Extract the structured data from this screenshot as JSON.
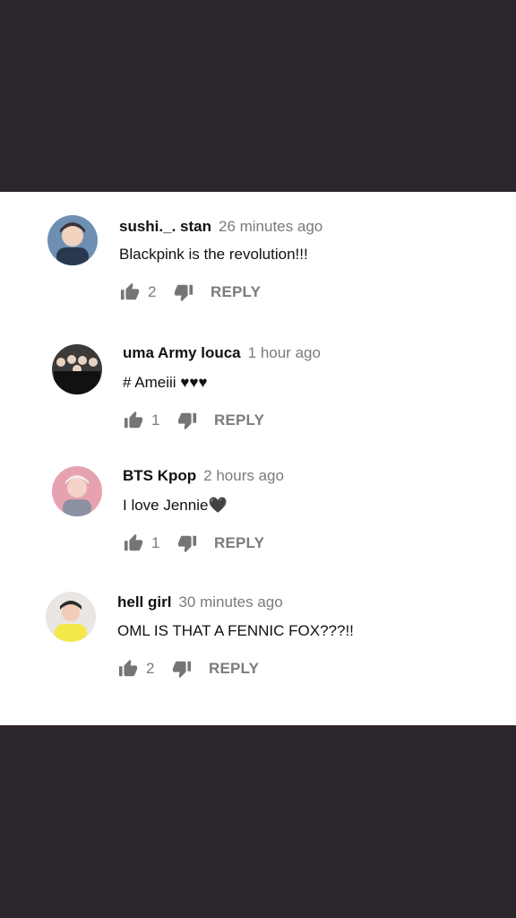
{
  "colors": {
    "background": "#2d252c",
    "panel": "#ffffff",
    "text": "#111111",
    "muted": "#7b7b7b"
  },
  "comments": [
    {
      "author": "sushi._. stan",
      "time": "26 minutes ago",
      "text": "Blackpink is the revolution!!!",
      "likes": "2",
      "reply_label": "REPLY",
      "avatar_icon": "avatar-photo"
    },
    {
      "author": "uma Army louca",
      "time": "1 hour ago",
      "text": "# Ameiii ♥♥♥",
      "likes": "1",
      "reply_label": "REPLY",
      "avatar_icon": "avatar-photo"
    },
    {
      "author": "BTS Kpop",
      "time": "2 hours ago",
      "text": "I love Jennie🖤",
      "likes": "1",
      "reply_label": "REPLY",
      "avatar_icon": "avatar-photo"
    },
    {
      "author": "hell girl",
      "time": "30 minutes ago",
      "text": "OML IS THAT A FENNIC FOX???!!",
      "likes": "2",
      "reply_label": "REPLY",
      "avatar_icon": "avatar-photo"
    }
  ],
  "icons": {
    "like": "thumbs-up-icon",
    "dislike": "thumbs-down-icon"
  }
}
